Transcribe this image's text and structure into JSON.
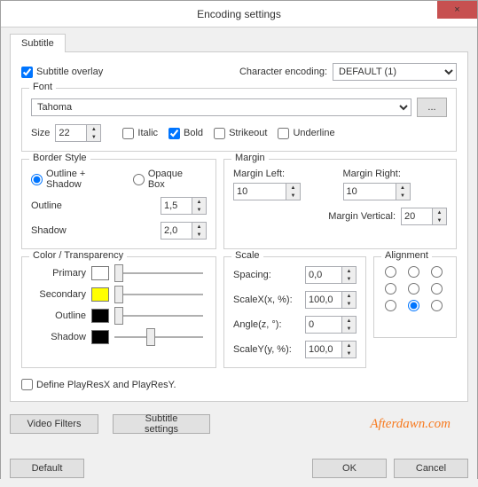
{
  "title": "Encoding settings",
  "close_icon": "×",
  "tab": "Subtitle",
  "overlay_label": "Subtitle overlay",
  "overlay_checked": true,
  "encoding_label": "Character encoding:",
  "encoding_value": "DEFAULT (1)",
  "font": {
    "legend": "Font",
    "value": "Tahoma",
    "browse": "...",
    "size_label": "Size",
    "size_value": "22",
    "italic": "Italic",
    "italic_checked": false,
    "bold": "Bold",
    "bold_checked": true,
    "strikeout": "Strikeout",
    "strikeout_checked": false,
    "underline": "Underline",
    "underline_checked": false
  },
  "border": {
    "legend": "Border Style",
    "outline_shadow": "Outline + Shadow",
    "opaque_box": "Opaque Box",
    "outline_label": "Outline",
    "outline_value": "1,5",
    "shadow_label": "Shadow",
    "shadow_value": "2,0"
  },
  "margin": {
    "legend": "Margin",
    "left_label": "Margin Left:",
    "left_value": "10",
    "right_label": "Margin Right:",
    "right_value": "10",
    "vertical_label": "Margin Vertical:",
    "vertical_value": "20"
  },
  "color": {
    "legend": "Color / Transparency",
    "primary": "Primary",
    "primary_color": "#ffffff",
    "secondary": "Secondary",
    "secondary_color": "#ffff00",
    "outline": "Outline",
    "outline_color": "#000000",
    "shadow": "Shadow",
    "shadow_color": "#000000"
  },
  "scale": {
    "legend": "Scale",
    "spacing_label": "Spacing:",
    "spacing_value": "0,0",
    "scalex_label": "ScaleX(x, %):",
    "scalex_value": "100,0",
    "angle_label": "Angle(z, °):",
    "angle_value": "0",
    "scaley_label": "ScaleY(y, %):",
    "scaley_value": "100,0"
  },
  "alignment": {
    "legend": "Alignment",
    "selected_index": 7
  },
  "playres_label": "Define PlayResX and PlayResY.",
  "playres_checked": false,
  "video_filters": "Video Filters",
  "subtitle_settings": "Subtitle settings",
  "watermark": "Afterdawn.com",
  "default_btn": "Default",
  "ok_btn": "OK",
  "cancel_btn": "Cancel"
}
